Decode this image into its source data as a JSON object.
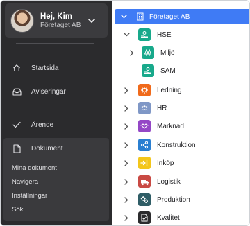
{
  "user": {
    "name": "Hej, Kim",
    "org": "Företaget AB"
  },
  "nav": {
    "items": [
      {
        "label": "Startsida",
        "icon": "home-icon"
      },
      {
        "label": "Aviseringar",
        "icon": "inbox-icon"
      },
      {
        "label": "Ärende",
        "icon": "checkmark-icon"
      }
    ],
    "documents": {
      "label": "Dokument",
      "icon": "document-icon",
      "subitems": [
        "Mina dokument",
        "Navigera",
        "Inställningar",
        "Sök"
      ]
    }
  },
  "tree": {
    "root": {
      "label": "Företaget AB",
      "icon": "building-icon",
      "expanded": true
    },
    "items": [
      {
        "label": "HSE",
        "icon": "hand-icon",
        "color": "#18a98b",
        "expanded": true,
        "level": 1
      },
      {
        "label": "Miljö",
        "icon": "trees-icon",
        "color": "#18a98b",
        "expanded": false,
        "level": 2
      },
      {
        "label": "SAM",
        "icon": "hand-icon",
        "color": "#18a98b",
        "expanded": null,
        "level": 2
      },
      {
        "label": "Ledning",
        "icon": "gear-icon",
        "color": "#f06a1b",
        "expanded": false,
        "level": 1
      },
      {
        "label": "HR",
        "icon": "people-icon",
        "color": "#7f97c6",
        "expanded": false,
        "level": 1
      },
      {
        "label": "Marknad",
        "icon": "handshake-icon",
        "color": "#9447c6",
        "expanded": false,
        "level": 1
      },
      {
        "label": "Konstruktion",
        "icon": "share-nodes-icon",
        "color": "#2a7fd1",
        "expanded": false,
        "level": 1
      },
      {
        "label": "Inköp",
        "icon": "arrow-in-icon",
        "color": "#f3c61a",
        "expanded": false,
        "level": 1
      },
      {
        "label": "Logistik",
        "icon": "truck-icon",
        "color": "#c94a44",
        "expanded": false,
        "level": 1
      },
      {
        "label": "Produktion",
        "icon": "cogs-icon",
        "color": "#2f5d66",
        "expanded": false,
        "level": 1
      },
      {
        "label": "Kvalitet",
        "icon": "checklist-icon",
        "color": "#2b2b2d",
        "expanded": false,
        "level": 1
      }
    ]
  },
  "colors": {
    "sidebar": "#2b2b2d",
    "accent": "#3f7bf5"
  }
}
